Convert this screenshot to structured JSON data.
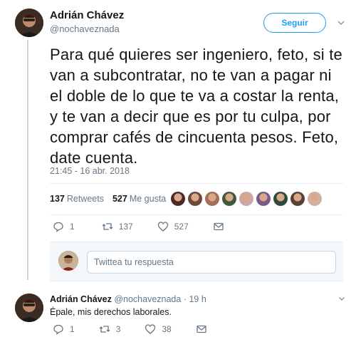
{
  "tweet": {
    "author_name": "Adrián Chávez",
    "author_handle": "@nochaveznada",
    "follow_label": "Seguir",
    "text": "Para qué quieres ser ingeniero, feto, si te van a subcontratar, no te van a pagar ni el doble de lo que te va a costar la renta, y te van a decir que es por tu culpa, por comprar cafés de cincuenta pesos. Feto, date cuenta.",
    "timestamp": "21:45 - 16 abr. 2018",
    "stats": {
      "retweets_count": "137",
      "retweets_label": "Retweets",
      "likes_count": "527",
      "likes_label": "Me gusta"
    },
    "actions": {
      "reply_count": "1",
      "retweet_count": "137",
      "like_count": "527"
    }
  },
  "reply_box": {
    "placeholder": "Twittea tu respuesta"
  },
  "reply_tweet": {
    "author_name": "Adrián Chávez",
    "author_handle": "@nochaveznada",
    "time": "· 19 h",
    "text": "Épale, mis derechos laborales.",
    "actions": {
      "reply_count": "1",
      "retweet_count": "3",
      "like_count": "38"
    }
  },
  "colors": {
    "accent": "#1da1f2",
    "secondary_text": "#657786"
  },
  "liker_colors": [
    "#4a2a22",
    "#6b4a3a",
    "#a0705a",
    "#3f5a3a",
    "#c9a9a6",
    "#7a5a8a",
    "#2f4a3a",
    "#5a4030",
    "#d0b0a0"
  ]
}
